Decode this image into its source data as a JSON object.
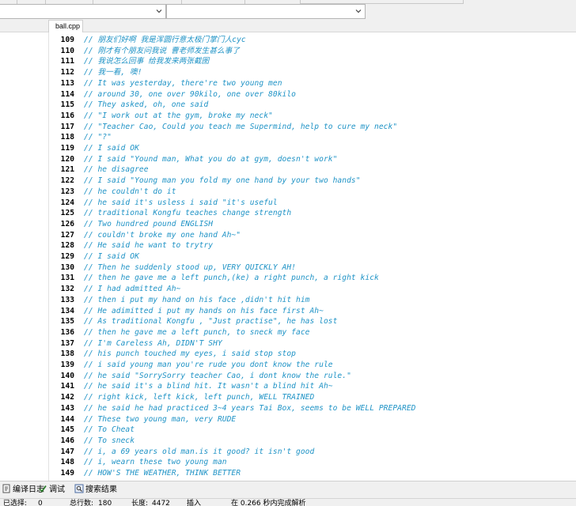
{
  "editor": {
    "file_tab": "ball.cpp",
    "lines": [
      {
        "n": "109",
        "text": "// 朋友们好啊 我是浑圆行意太极门掌门人cyc"
      },
      {
        "n": "110",
        "text": "// 刚才有个朋友问我说 曹老师发生甚么事了"
      },
      {
        "n": "111",
        "text": "// 我说怎么回事 给我发来两张截图"
      },
      {
        "n": "112",
        "text": "// 我一看, 噢!"
      },
      {
        "n": "113",
        "text": "// It was yesterday, there're two young men"
      },
      {
        "n": "114",
        "text": "// around 30, one over 90kilo, one over 80kilo"
      },
      {
        "n": "115",
        "text": "// They asked, oh, one said"
      },
      {
        "n": "116",
        "text": "// \"I work out at the gym, broke my neck\""
      },
      {
        "n": "117",
        "text": "// \"Teacher Cao, Could you teach me Supermind, help to cure my neck\""
      },
      {
        "n": "118",
        "text": "// \"?\""
      },
      {
        "n": "119",
        "text": "// I said OK"
      },
      {
        "n": "120",
        "text": "// I said \"Yound man, What you do at gym, doesn't work\""
      },
      {
        "n": "121",
        "text": "// he disagree"
      },
      {
        "n": "122",
        "text": "// I said \"Young man you fold my one hand by your two hands\""
      },
      {
        "n": "123",
        "text": "// he couldn't do it"
      },
      {
        "n": "124",
        "text": "// he said it's usless i said \"it's useful"
      },
      {
        "n": "125",
        "text": "// traditional Kongfu teaches change strength"
      },
      {
        "n": "126",
        "text": "// Two hundred pound ENGLISH"
      },
      {
        "n": "127",
        "text": "// couldn't broke my one hand Ah~\""
      },
      {
        "n": "128",
        "text": "// He said he want to trytry"
      },
      {
        "n": "129",
        "text": "// I said OK"
      },
      {
        "n": "130",
        "text": "// Then he suddenly stood up, VERY QUICKLY AH!"
      },
      {
        "n": "131",
        "text": "// then he gave me a left punch,(ke) a right punch, a right kick"
      },
      {
        "n": "132",
        "text": "// I had admitted Ah~"
      },
      {
        "n": "133",
        "text": "// then i put my hand on his face ,didn't hit him"
      },
      {
        "n": "134",
        "text": "// He adimitted i put my hands on his face first Ah~"
      },
      {
        "n": "135",
        "text": "// As traditional Kongfu , \"Just practise\", he has lost"
      },
      {
        "n": "136",
        "text": "// then he gave me a left punch, to sneck my face"
      },
      {
        "n": "137",
        "text": "// I'm Careless Ah, DIDN'T SHY"
      },
      {
        "n": "138",
        "text": "// his punch touched my eyes, i said stop stop"
      },
      {
        "n": "139",
        "text": "// i said young man you're rude you dont know the rule"
      },
      {
        "n": "140",
        "text": "// he said \"SorrySorry teacher Cao, i dont know the rule.\""
      },
      {
        "n": "141",
        "text": "// he said it's a blind hit. It wasn't a blind hit Ah~"
      },
      {
        "n": "142",
        "text": "// right kick, left kick, left punch, WELL TRAINED"
      },
      {
        "n": "143",
        "text": "// he said he had practiced 3~4 years Tai Box, seems to be WELL PREPARED"
      },
      {
        "n": "144",
        "text": "// These two young man, very RUDE"
      },
      {
        "n": "145",
        "text": "// To Cheat"
      },
      {
        "n": "146",
        "text": "// To sneck"
      },
      {
        "n": "147",
        "text": "// i, a 69 years old man.is it good? it isn't good"
      },
      {
        "n": "148",
        "text": "// i, wearn these two young man"
      },
      {
        "n": "149",
        "text": "// HOW'S THE WEATHER, THINK BETTER"
      }
    ]
  },
  "bottom_tabs": [
    {
      "label": "编译日志",
      "icon": "log-icon"
    },
    {
      "label": "调试",
      "icon": "check-icon"
    },
    {
      "label": "搜索结果",
      "icon": "search-results-icon"
    }
  ],
  "status": {
    "selected_label": "已选择:",
    "selected_value": "0",
    "total_lines_label": "总行数:",
    "total_lines_value": "180",
    "length_label": "长度:",
    "length_value": "4472",
    "insert_mode": "插入",
    "parse_message": "在 0.266 秒内完成解析"
  },
  "colors": {
    "comment": "#1f93c6",
    "line_number": "#000000",
    "editor_bg": "#ffffff",
    "chrome_bg": "#f0f0f0"
  }
}
